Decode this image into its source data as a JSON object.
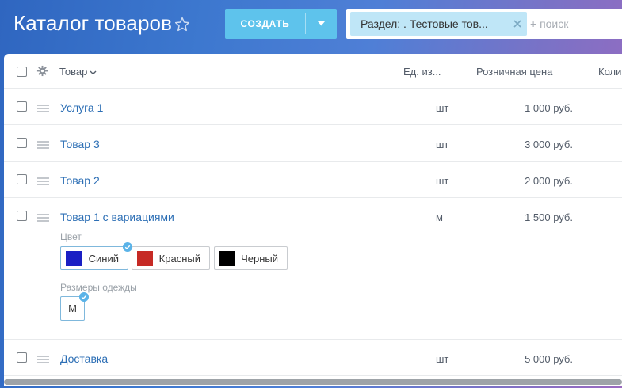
{
  "header": {
    "title": "Каталог товаров",
    "create_label": "СОЗДАТЬ",
    "filter_tag": "Раздел: . Тестовые тов...",
    "search_placeholder": "+ поиск"
  },
  "columns": {
    "product": "Товар",
    "unit": "Ед. из...",
    "price": "Розничная цена",
    "qty": "Коли"
  },
  "rows": [
    {
      "name": "Услуга 1",
      "unit": "шт",
      "price": "1 000 руб."
    },
    {
      "name": "Товар 3",
      "unit": "шт",
      "price": "3 000 руб."
    },
    {
      "name": "Товар 2",
      "unit": "шт",
      "price": "2 000 руб."
    },
    {
      "name": "Товар 1 с вариациями",
      "unit": "м",
      "price": "1 500 руб."
    },
    {
      "name": "Доставка",
      "unit": "шт",
      "price": "5 000 руб."
    }
  ],
  "variations": {
    "color_label": "Цвет",
    "colors": [
      {
        "label": "Синий",
        "swatch": "#1a1fc4",
        "selected": true
      },
      {
        "label": "Красный",
        "swatch": "#c62a25",
        "selected": false
      },
      {
        "label": "Черный",
        "swatch": "#000000",
        "selected": false
      }
    ],
    "size_label": "Размеры одежды",
    "sizes": [
      {
        "label": "M",
        "selected": true
      }
    ]
  },
  "colors": {
    "create_button": "#5ec3ec",
    "link": "#2d6fb5",
    "filter_tag_bg": "#bfe6f7",
    "check_badge": "#5ab3e8"
  }
}
